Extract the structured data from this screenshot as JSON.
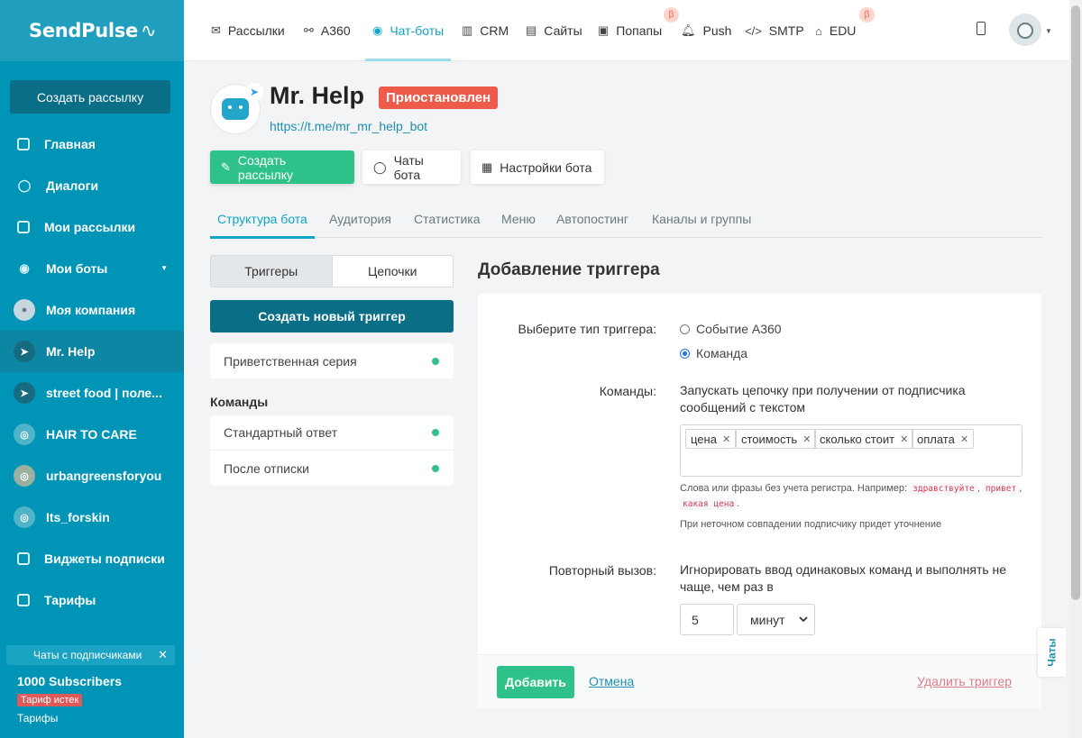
{
  "sidebar": {
    "logo": "SendPulse",
    "create_button": "Создать рассылку",
    "items": [
      {
        "label": "Главная"
      },
      {
        "label": "Диалоги"
      },
      {
        "label": "Мои рассылки"
      },
      {
        "label": "Мои боты"
      },
      {
        "label": "Моя компания"
      },
      {
        "label": "Mr. Help"
      },
      {
        "label": "street food | поле..."
      },
      {
        "label": "HAIR TO CARE"
      },
      {
        "label": "urbangreensforyou"
      },
      {
        "label": "Its_forskin"
      },
      {
        "label": "Виджеты подписки"
      },
      {
        "label": "Тарифы"
      }
    ],
    "chats_bar": "Чаты с подписчиками",
    "plan": "1000 Subscribers",
    "plan_status": "Тариф истек",
    "plan_link": "Тарифы"
  },
  "topnav": {
    "items": [
      {
        "label": "Рассылки"
      },
      {
        "label": "A360"
      },
      {
        "label": "Чат-боты"
      },
      {
        "label": "CRM"
      },
      {
        "label": "Сайты"
      },
      {
        "label": "Попапы"
      },
      {
        "label": "Push"
      },
      {
        "label": "SMTP"
      },
      {
        "label": "EDU"
      }
    ],
    "beta_label": "β"
  },
  "bot": {
    "name": "Mr. Help",
    "status": "Приостановлен",
    "link": "https://t.me/mr_mr_help_bot",
    "actions": {
      "create_mailing": "Создать рассылку",
      "chats": "Чаты бота",
      "settings": "Настройки бота"
    }
  },
  "tabs": [
    {
      "label": "Структура бота"
    },
    {
      "label": "Аудитория"
    },
    {
      "label": "Статистика"
    },
    {
      "label": "Меню"
    },
    {
      "label": "Автопостинг"
    },
    {
      "label": "Каналы и группы"
    }
  ],
  "left_panel": {
    "segment": {
      "triggers": "Триггеры",
      "chains": "Цепочки"
    },
    "create_trigger": "Создать новый триггер",
    "welcome": "Приветственная серия",
    "commands_title": "Команды",
    "commands": [
      {
        "label": "Стандартный ответ"
      },
      {
        "label": "После отписки"
      }
    ]
  },
  "form": {
    "title": "Добавление триггера",
    "trigger_type_label": "Выберите тип триггера:",
    "radio_event": "Событие A360",
    "radio_command": "Команда",
    "commands_label": "Команды:",
    "commands_desc": "Запускать цепочку при получении от подписчика сообщений с текстом",
    "tags": [
      "цена",
      "стоимость",
      "сколько стоит",
      "оплата"
    ],
    "hint_prefix": "Слова или фразы без учета регистра. Например:",
    "hint_examples": [
      "здравствуйте",
      "привет",
      "какая цена"
    ],
    "hint_fuzzy": "При неточном совпадении подписчику придет уточнение",
    "repeat_label": "Повторный вызов:",
    "repeat_desc": "Игнорировать ввод одинаковых команд и выполнять не чаще, чем раз в",
    "interval_value": "5",
    "interval_unit": "минут",
    "add_button": "Добавить",
    "cancel_link": "Отмена",
    "delete_link": "Удалить триггер"
  },
  "chats_tab": "Чаты"
}
